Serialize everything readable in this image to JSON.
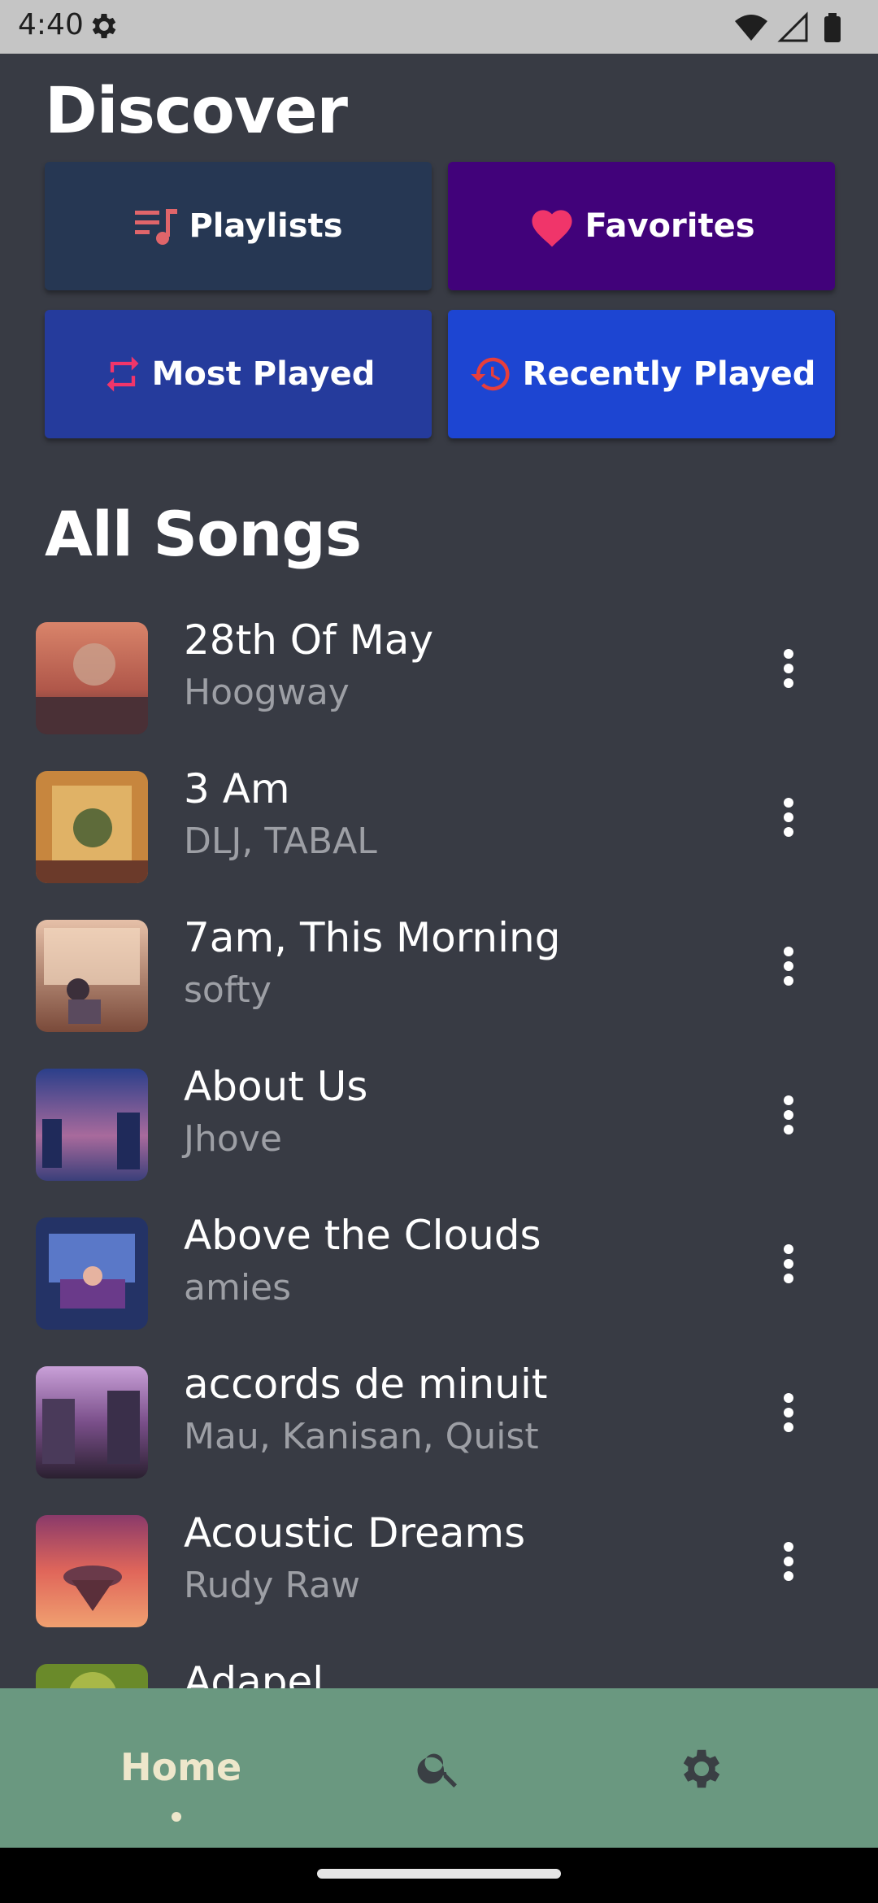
{
  "status_bar": {
    "time": "4:40"
  },
  "header": {
    "title": "Discover"
  },
  "tiles": [
    {
      "label": "Playlists",
      "icon": "playlist-music-icon",
      "color": "#263753"
    },
    {
      "label": "Favorites",
      "icon": "heart-icon",
      "color": "#41027a"
    },
    {
      "label": "Most Played",
      "icon": "repeat-icon",
      "color": "#253b9c"
    },
    {
      "label": "Recently Played",
      "icon": "history-icon",
      "color": "#1d45d2"
    }
  ],
  "all_songs": {
    "title": "All Songs",
    "songs": [
      {
        "title": "28th Of May",
        "artist": "Hoogway"
      },
      {
        "title": "3 Am",
        "artist": "DLJ, TABAL"
      },
      {
        "title": "7am, This Morning",
        "artist": "softy"
      },
      {
        "title": "About Us",
        "artist": "Jhove"
      },
      {
        "title": "Above the Clouds",
        "artist": "amies"
      },
      {
        "title": "accords de minuit",
        "artist": "Mau, Kanisan, Quist"
      },
      {
        "title": "Acoustic Dreams",
        "artist": "Rudy Raw"
      },
      {
        "title": "Adapel",
        "artist": ""
      }
    ]
  },
  "bottom_nav": {
    "home_label": "Home",
    "items": [
      "home",
      "search-icon",
      "gear-icon"
    ]
  },
  "colors": {
    "background": "#383b44",
    "nav_background": "#6a9880",
    "accent_pink": "#f0356a",
    "accent_red": "#e73e3c"
  }
}
